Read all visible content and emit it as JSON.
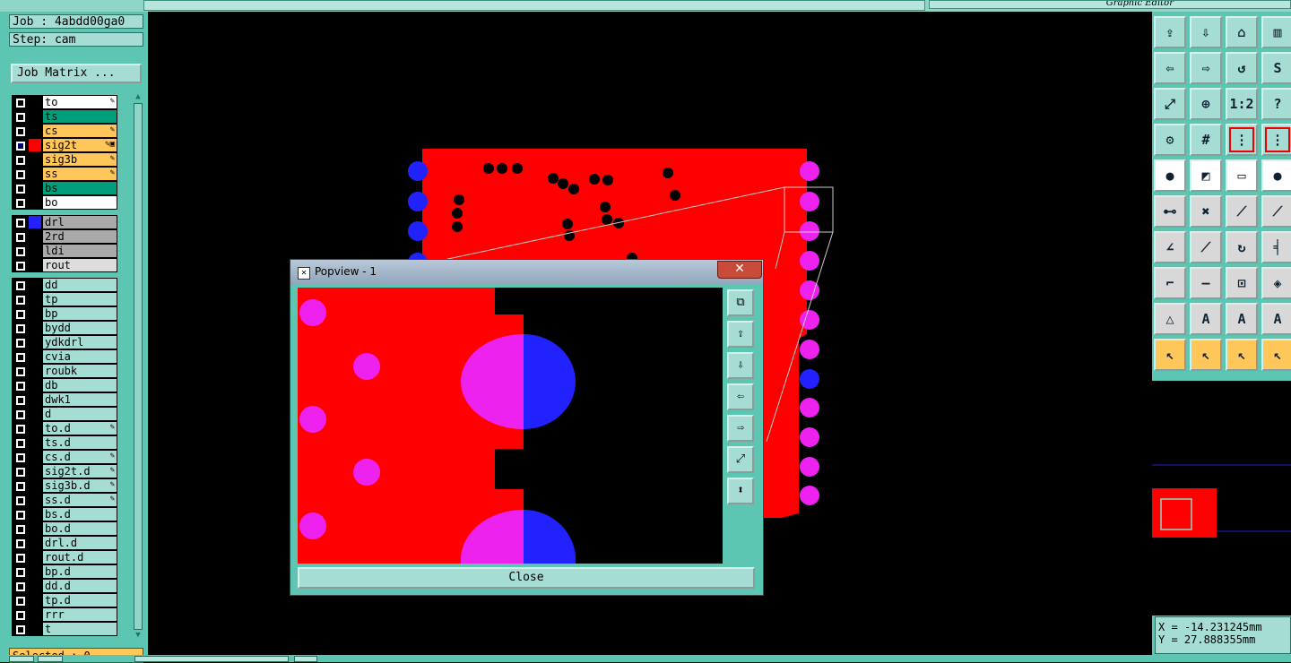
{
  "window_title": "Graphic Editor",
  "job": {
    "job_line": "Job : 4abdd00ga0",
    "step_line": "Step: cam",
    "matrix_button": "Job Matrix ..."
  },
  "colors": {
    "board": "#ff0000",
    "pad_magenta": "#ee22ee",
    "pad_blue": "#2222ff",
    "panel": "#5cc6b3",
    "panel_light": "#a5dcd3",
    "highlight_orange": "#ffc65a",
    "affected_green": "#009e7a",
    "layer_gray": "#aaaaaa"
  },
  "layer_groups": [
    [
      {
        "name": "to",
        "bg": "#ffffff",
        "color": "",
        "checked": false,
        "flag": "✎"
      },
      {
        "name": "ts",
        "bg": "#009e7a",
        "color": "",
        "checked": false,
        "flag": ""
      },
      {
        "name": "cs",
        "bg": "#ffc65a",
        "color": "",
        "checked": false,
        "flag": "✎"
      },
      {
        "name": "sig2t",
        "bg": "#ffc65a",
        "color": "#ff0000",
        "checked": true,
        "flag": "✎▣"
      },
      {
        "name": "sig3b",
        "bg": "#ffc65a",
        "color": "",
        "checked": false,
        "flag": "✎"
      },
      {
        "name": "ss",
        "bg": "#ffc65a",
        "color": "",
        "checked": false,
        "flag": "✎"
      },
      {
        "name": "bs",
        "bg": "#009e7a",
        "color": "",
        "checked": false,
        "flag": ""
      },
      {
        "name": "bo",
        "bg": "#ffffff",
        "color": "",
        "checked": false,
        "flag": ""
      }
    ],
    [
      {
        "name": "drl",
        "bg": "#aaaaaa",
        "color": "#2222ff",
        "checked": false,
        "flag": ""
      },
      {
        "name": "2rd",
        "bg": "#aaaaaa",
        "color": "",
        "checked": false,
        "flag": ""
      },
      {
        "name": "ldi",
        "bg": "#aaaaaa",
        "color": "",
        "checked": false,
        "flag": ""
      },
      {
        "name": "rout",
        "bg": "#dddddd",
        "color": "",
        "checked": false,
        "flag": ""
      }
    ],
    [
      {
        "name": "dd",
        "bg": "#a5dcd3",
        "color": "",
        "checked": false,
        "flag": ""
      },
      {
        "name": "tp",
        "bg": "#a5dcd3",
        "color": "",
        "checked": false,
        "flag": ""
      },
      {
        "name": "bp",
        "bg": "#a5dcd3",
        "color": "",
        "checked": false,
        "flag": ""
      },
      {
        "name": "bydd",
        "bg": "#a5dcd3",
        "color": "",
        "checked": false,
        "flag": ""
      },
      {
        "name": "ydkdrl",
        "bg": "#a5dcd3",
        "color": "",
        "checked": false,
        "flag": ""
      },
      {
        "name": "cvia",
        "bg": "#a5dcd3",
        "color": "",
        "checked": false,
        "flag": ""
      },
      {
        "name": "roubk",
        "bg": "#a5dcd3",
        "color": "",
        "checked": false,
        "flag": ""
      },
      {
        "name": "db",
        "bg": "#a5dcd3",
        "color": "",
        "checked": false,
        "flag": ""
      },
      {
        "name": "dwk1",
        "bg": "#a5dcd3",
        "color": "",
        "checked": false,
        "flag": ""
      },
      {
        "name": "d",
        "bg": "#a5dcd3",
        "color": "",
        "checked": false,
        "flag": ""
      },
      {
        "name": "to.d",
        "bg": "#a5dcd3",
        "color": "",
        "checked": false,
        "flag": "✎"
      },
      {
        "name": "ts.d",
        "bg": "#a5dcd3",
        "color": "",
        "checked": false,
        "flag": ""
      },
      {
        "name": "cs.d",
        "bg": "#a5dcd3",
        "color": "",
        "checked": false,
        "flag": "✎"
      },
      {
        "name": "sig2t.d",
        "bg": "#a5dcd3",
        "color": "",
        "checked": false,
        "flag": "✎"
      },
      {
        "name": "sig3b.d",
        "bg": "#a5dcd3",
        "color": "",
        "checked": false,
        "flag": "✎"
      },
      {
        "name": "ss.d",
        "bg": "#a5dcd3",
        "color": "",
        "checked": false,
        "flag": "✎"
      },
      {
        "name": "bs.d",
        "bg": "#a5dcd3",
        "color": "",
        "checked": false,
        "flag": ""
      },
      {
        "name": "bo.d",
        "bg": "#a5dcd3",
        "color": "",
        "checked": false,
        "flag": ""
      },
      {
        "name": "drl.d",
        "bg": "#a5dcd3",
        "color": "",
        "checked": false,
        "flag": ""
      },
      {
        "name": "rout.d",
        "bg": "#a5dcd3",
        "color": "",
        "checked": false,
        "flag": ""
      },
      {
        "name": "bp.d",
        "bg": "#a5dcd3",
        "color": "",
        "checked": false,
        "flag": ""
      },
      {
        "name": "dd.d",
        "bg": "#a5dcd3",
        "color": "",
        "checked": false,
        "flag": ""
      },
      {
        "name": "tp.d",
        "bg": "#a5dcd3",
        "color": "",
        "checked": false,
        "flag": ""
      },
      {
        "name": "rrr",
        "bg": "#a5dcd3",
        "color": "",
        "checked": false,
        "flag": ""
      },
      {
        "name": "t",
        "bg": "#a5dcd3",
        "color": "",
        "checked": false,
        "flag": ""
      }
    ]
  ],
  "selected_label": "Selected : 0",
  "tools": [
    {
      "name": "move-up-tool",
      "glyph": "⇪",
      "style": "t"
    },
    {
      "name": "move-down-tool",
      "glyph": "⇩",
      "style": "t"
    },
    {
      "name": "home-tool",
      "glyph": "⌂",
      "style": "t"
    },
    {
      "name": "window-tool",
      "glyph": "▥",
      "style": "t"
    },
    {
      "name": "move-left-tool",
      "glyph": "⇦",
      "style": "t"
    },
    {
      "name": "move-right-tool",
      "glyph": "⇨",
      "style": "t"
    },
    {
      "name": "undo-zoom-tool",
      "glyph": "↺",
      "style": "t"
    },
    {
      "name": "redraw-tool",
      "glyph": "S",
      "style": "t"
    },
    {
      "name": "zoom-fit-tool",
      "glyph": "⤢",
      "style": "t"
    },
    {
      "name": "zoom-center-tool",
      "glyph": "⊕",
      "style": "t"
    },
    {
      "name": "scale-1-2-tool",
      "glyph": "1:2",
      "style": "t"
    },
    {
      "name": "help-tool",
      "glyph": "?",
      "style": "t"
    },
    {
      "name": "settings-tool",
      "glyph": "⚙",
      "style": "t"
    },
    {
      "name": "grid-tool",
      "glyph": "#",
      "style": "t"
    },
    {
      "name": "snap-tool",
      "glyph": "⋮",
      "style": "t",
      "sel": true
    },
    {
      "name": "snap-center-tool",
      "glyph": "⋮",
      "style": "t",
      "sel": true
    },
    {
      "name": "pad-tool",
      "glyph": "●",
      "style": "w"
    },
    {
      "name": "line-color-tool",
      "glyph": "◩",
      "style": "w"
    },
    {
      "name": "ruler-tool",
      "glyph": "▭",
      "style": "w"
    },
    {
      "name": "round-pad-tool",
      "glyph": "●",
      "style": "w"
    },
    {
      "name": "connect-tool",
      "glyph": "⊷",
      "style": "g"
    },
    {
      "name": "cross-tool",
      "glyph": "✖",
      "style": "g"
    },
    {
      "name": "segment-tool",
      "glyph": "⟋",
      "style": "g"
    },
    {
      "name": "segment2-tool",
      "glyph": "⟋",
      "style": "g"
    },
    {
      "name": "angle-tool",
      "glyph": "∠",
      "style": "g"
    },
    {
      "name": "diagonal-tool",
      "glyph": "⟋",
      "style": "g"
    },
    {
      "name": "arc-tool",
      "glyph": "↻",
      "style": "g"
    },
    {
      "name": "trace-tool",
      "glyph": "╡",
      "style": "g"
    },
    {
      "name": "corner-tool",
      "glyph": "⌐",
      "style": "g"
    },
    {
      "name": "minus-tool",
      "glyph": "—",
      "style": "g"
    },
    {
      "name": "measure-tool",
      "glyph": "⊡",
      "style": "g"
    },
    {
      "name": "shapes-tool",
      "glyph": "◈",
      "style": "g"
    },
    {
      "name": "triangle-tool",
      "glyph": "△",
      "style": "g"
    },
    {
      "name": "arrow-up-tool",
      "glyph": "A",
      "style": "g"
    },
    {
      "name": "arch-tool",
      "glyph": "A",
      "style": "g"
    },
    {
      "name": "arch2-tool",
      "glyph": "A",
      "style": "g"
    },
    {
      "name": "pointer-tool",
      "glyph": "↖",
      "style": "o"
    },
    {
      "name": "pointer-box-tool",
      "glyph": "↖",
      "style": "o"
    },
    {
      "name": "pointer-circle-tool",
      "glyph": "↖",
      "style": "o"
    },
    {
      "name": "pointer-net-tool",
      "glyph": "↖",
      "style": "o"
    }
  ],
  "coordinates": {
    "x": "X = -14.231245mm",
    "y": "Y = 27.888355mm"
  },
  "popview": {
    "title": "Popview - 1",
    "close_label": "Close",
    "tools": [
      "⧉",
      "⇪",
      "⇩",
      "⇦",
      "⇨",
      "⤢",
      "⬍"
    ]
  }
}
